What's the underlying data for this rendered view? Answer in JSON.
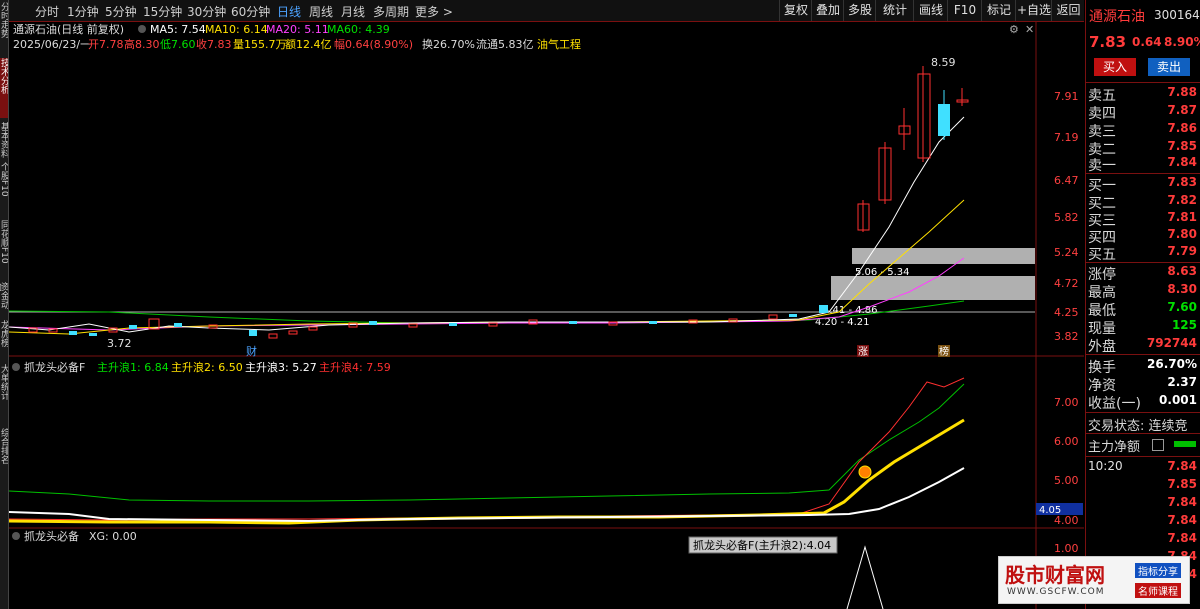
{
  "left_tabs": [
    "分时走势",
    "技术分析",
    "基本资料",
    "个股F10",
    "同花顺F10",
    "资金动向",
    "龙虎榜",
    "大单统计",
    "综合排名",
    "行情报价"
  ],
  "periods": [
    "分时",
    "1分钟",
    "5分钟",
    "15分钟",
    "30分钟",
    "60分钟",
    "日线",
    "周线",
    "月线",
    "多周期",
    "更多 >"
  ],
  "active_period": "日线",
  "toolbar": [
    "复权",
    "叠加",
    "多股",
    "统计",
    "画线",
    "F10",
    "标记",
    "+自选",
    "返回"
  ],
  "main_chart": {
    "title": "通源石油(日线 前复权)",
    "ma5": "MA5: 7.54",
    "ma10": "MA10: 6.14",
    "ma20": "MA20: 5.11",
    "ma60": "MA60: 4.39",
    "info_date": "2025/06/23/一",
    "open": "开7.78",
    "high": "高8.30",
    "low": "低7.60",
    "close": "收7.83",
    "volume": "量155.7万",
    "amount": "额12.4亿",
    "change": "幅0.64(8.90%)",
    "turnover": "换26.70%",
    "float": "流通5.83亿",
    "sector": "油气工程",
    "y_ticks": [
      "7.91",
      "7.19",
      "6.47",
      "5.82",
      "5.24",
      "4.72",
      "4.25",
      "3.82"
    ],
    "hi_label": "8.59",
    "lo_label": "3.72",
    "zone1_label": "5.06 - 5.34",
    "zone2_label": "4.41 - 4.86",
    "zone3_label": "4.20 - 4.21",
    "marker_cai": "财",
    "marker_zhang": "涨",
    "marker_bang": "榜"
  },
  "indicator1": {
    "name": "抓龙头必备F",
    "l1": "主升浪1: 6.84",
    "l2": "主升浪2: 6.50",
    "l3": "主升浪3: 5.27",
    "l4": "主升浪4: 7.59",
    "y_ticks": [
      "7.00",
      "6.00",
      "5.00",
      "4.00"
    ],
    "badge": "4.05"
  },
  "indicator2": {
    "name": "抓龙头必备",
    "xg": "XG: 0.00",
    "tooltip": "抓龙头必备F(主升浪2):4.04",
    "y_tick": "1.00"
  },
  "quote": {
    "name": "通源石油",
    "code": "300164",
    "price": "7.83",
    "change": "0.64",
    "pct": "8.90%",
    "buy_btn": "买入",
    "sell_btn": "卖出",
    "asks": [
      {
        "l": "卖五",
        "v": "7.88"
      },
      {
        "l": "卖四",
        "v": "7.87"
      },
      {
        "l": "卖三",
        "v": "7.86"
      },
      {
        "l": "卖二",
        "v": "7.85"
      },
      {
        "l": "卖一",
        "v": "7.84"
      }
    ],
    "bids": [
      {
        "l": "买一",
        "v": "7.83"
      },
      {
        "l": "买二",
        "v": "7.82"
      },
      {
        "l": "买三",
        "v": "7.81"
      },
      {
        "l": "买四",
        "v": "7.80"
      },
      {
        "l": "买五",
        "v": "7.79"
      }
    ],
    "stats": [
      {
        "l": "涨停",
        "v": "8.63"
      },
      {
        "l": "最高",
        "v": "8.30"
      },
      {
        "l": "最低",
        "v": "7.60"
      },
      {
        "l": "现量",
        "v": "125"
      },
      {
        "l": "外盘",
        "v": "792744"
      }
    ],
    "stats2": [
      {
        "l": "换手",
        "v": "26.70%"
      },
      {
        "l": "净资",
        "v": "2.37"
      },
      {
        "l": "收益(一)",
        "v": "0.001"
      }
    ],
    "trade_state": "交易状态: 连续竞",
    "net_flow": "主力净额",
    "ticks_time": "10:20",
    "ticks": [
      "7.84",
      "7.85",
      "7.84",
      "7.84",
      "7.84",
      "7.84",
      "7.84"
    ]
  },
  "watermark": {
    "main": "股市财富网",
    "url": "WWW.GSCFW.COM",
    "tag1": "指标分享",
    "tag2": "名师课程"
  }
}
